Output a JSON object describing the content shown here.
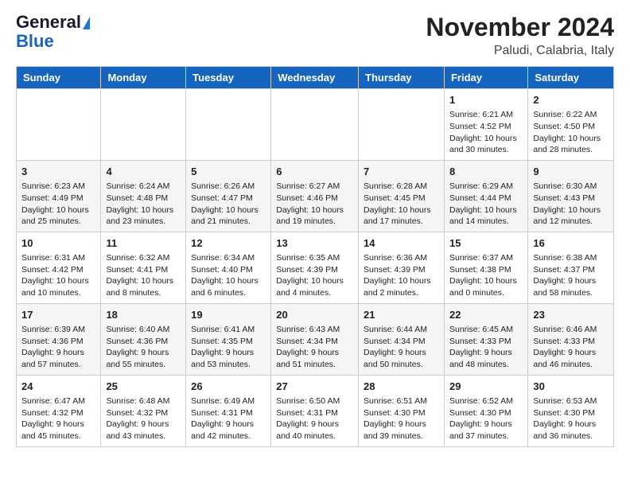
{
  "header": {
    "logo_line1": "General",
    "logo_line2": "Blue",
    "month": "November 2024",
    "location": "Paludi, Calabria, Italy"
  },
  "days_of_week": [
    "Sunday",
    "Monday",
    "Tuesday",
    "Wednesday",
    "Thursday",
    "Friday",
    "Saturday"
  ],
  "weeks": [
    [
      {
        "day": "",
        "info": ""
      },
      {
        "day": "",
        "info": ""
      },
      {
        "day": "",
        "info": ""
      },
      {
        "day": "",
        "info": ""
      },
      {
        "day": "",
        "info": ""
      },
      {
        "day": "1",
        "info": "Sunrise: 6:21 AM\nSunset: 4:52 PM\nDaylight: 10 hours\nand 30 minutes."
      },
      {
        "day": "2",
        "info": "Sunrise: 6:22 AM\nSunset: 4:50 PM\nDaylight: 10 hours\nand 28 minutes."
      }
    ],
    [
      {
        "day": "3",
        "info": "Sunrise: 6:23 AM\nSunset: 4:49 PM\nDaylight: 10 hours\nand 25 minutes."
      },
      {
        "day": "4",
        "info": "Sunrise: 6:24 AM\nSunset: 4:48 PM\nDaylight: 10 hours\nand 23 minutes."
      },
      {
        "day": "5",
        "info": "Sunrise: 6:26 AM\nSunset: 4:47 PM\nDaylight: 10 hours\nand 21 minutes."
      },
      {
        "day": "6",
        "info": "Sunrise: 6:27 AM\nSunset: 4:46 PM\nDaylight: 10 hours\nand 19 minutes."
      },
      {
        "day": "7",
        "info": "Sunrise: 6:28 AM\nSunset: 4:45 PM\nDaylight: 10 hours\nand 17 minutes."
      },
      {
        "day": "8",
        "info": "Sunrise: 6:29 AM\nSunset: 4:44 PM\nDaylight: 10 hours\nand 14 minutes."
      },
      {
        "day": "9",
        "info": "Sunrise: 6:30 AM\nSunset: 4:43 PM\nDaylight: 10 hours\nand 12 minutes."
      }
    ],
    [
      {
        "day": "10",
        "info": "Sunrise: 6:31 AM\nSunset: 4:42 PM\nDaylight: 10 hours\nand 10 minutes."
      },
      {
        "day": "11",
        "info": "Sunrise: 6:32 AM\nSunset: 4:41 PM\nDaylight: 10 hours\nand 8 minutes."
      },
      {
        "day": "12",
        "info": "Sunrise: 6:34 AM\nSunset: 4:40 PM\nDaylight: 10 hours\nand 6 minutes."
      },
      {
        "day": "13",
        "info": "Sunrise: 6:35 AM\nSunset: 4:39 PM\nDaylight: 10 hours\nand 4 minutes."
      },
      {
        "day": "14",
        "info": "Sunrise: 6:36 AM\nSunset: 4:39 PM\nDaylight: 10 hours\nand 2 minutes."
      },
      {
        "day": "15",
        "info": "Sunrise: 6:37 AM\nSunset: 4:38 PM\nDaylight: 10 hours\nand 0 minutes."
      },
      {
        "day": "16",
        "info": "Sunrise: 6:38 AM\nSunset: 4:37 PM\nDaylight: 9 hours\nand 58 minutes."
      }
    ],
    [
      {
        "day": "17",
        "info": "Sunrise: 6:39 AM\nSunset: 4:36 PM\nDaylight: 9 hours\nand 57 minutes."
      },
      {
        "day": "18",
        "info": "Sunrise: 6:40 AM\nSunset: 4:36 PM\nDaylight: 9 hours\nand 55 minutes."
      },
      {
        "day": "19",
        "info": "Sunrise: 6:41 AM\nSunset: 4:35 PM\nDaylight: 9 hours\nand 53 minutes."
      },
      {
        "day": "20",
        "info": "Sunrise: 6:43 AM\nSunset: 4:34 PM\nDaylight: 9 hours\nand 51 minutes."
      },
      {
        "day": "21",
        "info": "Sunrise: 6:44 AM\nSunset: 4:34 PM\nDaylight: 9 hours\nand 50 minutes."
      },
      {
        "day": "22",
        "info": "Sunrise: 6:45 AM\nSunset: 4:33 PM\nDaylight: 9 hours\nand 48 minutes."
      },
      {
        "day": "23",
        "info": "Sunrise: 6:46 AM\nSunset: 4:33 PM\nDaylight: 9 hours\nand 46 minutes."
      }
    ],
    [
      {
        "day": "24",
        "info": "Sunrise: 6:47 AM\nSunset: 4:32 PM\nDaylight: 9 hours\nand 45 minutes."
      },
      {
        "day": "25",
        "info": "Sunrise: 6:48 AM\nSunset: 4:32 PM\nDaylight: 9 hours\nand 43 minutes."
      },
      {
        "day": "26",
        "info": "Sunrise: 6:49 AM\nSunset: 4:31 PM\nDaylight: 9 hours\nand 42 minutes."
      },
      {
        "day": "27",
        "info": "Sunrise: 6:50 AM\nSunset: 4:31 PM\nDaylight: 9 hours\nand 40 minutes."
      },
      {
        "day": "28",
        "info": "Sunrise: 6:51 AM\nSunset: 4:30 PM\nDaylight: 9 hours\nand 39 minutes."
      },
      {
        "day": "29",
        "info": "Sunrise: 6:52 AM\nSunset: 4:30 PM\nDaylight: 9 hours\nand 37 minutes."
      },
      {
        "day": "30",
        "info": "Sunrise: 6:53 AM\nSunset: 4:30 PM\nDaylight: 9 hours\nand 36 minutes."
      }
    ]
  ]
}
